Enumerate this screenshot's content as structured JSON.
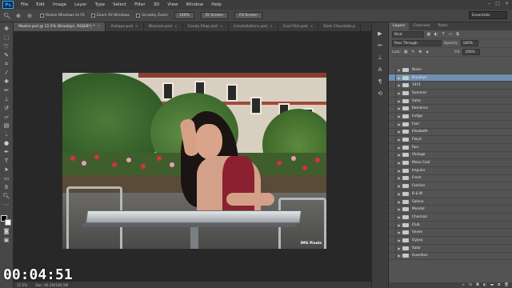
{
  "app": {
    "logo": "Ps"
  },
  "menu": [
    "File",
    "Edit",
    "Image",
    "Layer",
    "Type",
    "Select",
    "Filter",
    "3D",
    "View",
    "Window",
    "Help"
  ],
  "options": {
    "resize_windows": "Resize Windows to Fit",
    "zoom_all": "Zoom All Windows",
    "scrubby": "Scrubby Zoom",
    "btn_100": "100%",
    "fit_screen": "Fit Screen",
    "fill_screen": "Fill Screen",
    "workspace": "Essentials"
  },
  "tabs": [
    "Master.psd @ 12.5% (Brooklyn, RGB/8*) *",
    "Antique.psd",
    "Blossom.psd",
    "Candy Shop.psd",
    "Constellations.psd",
    "Cool Film.psd",
    "Dark Chocolate.p"
  ],
  "status": {
    "zoom": "12.5%",
    "doc": "Doc: 60.2M/180.5M"
  },
  "timer": "00:04:51",
  "panel": {
    "tabs": [
      "Layers",
      "Channels",
      "Paths"
    ],
    "kind": "Kind",
    "blend": "Pass Through",
    "opacity_label": "Opacity:",
    "opacity": "100%",
    "lock_label": "Lock:",
    "fill_label": "Fill:",
    "fill": "100%"
  },
  "layers": [
    "Noise",
    "Brooklyn",
    "1971",
    "Summer",
    "Saha",
    "Romance",
    "Indigo",
    "Feel",
    "Elizabeth",
    "Floyd",
    "Run",
    "Vintage",
    "Mono Cool",
    "Impuler",
    "Fresh",
    "Fashion",
    "B & W",
    "Salena",
    "Mondal",
    "Charcoal",
    "Club",
    "Seven",
    "Gypsy",
    "Solar",
    "Guardian"
  ],
  "photo_watermark": "IMG Pixels",
  "colors": {
    "selected_layer": "#6f8fb0",
    "accent": "#31a8ff"
  }
}
